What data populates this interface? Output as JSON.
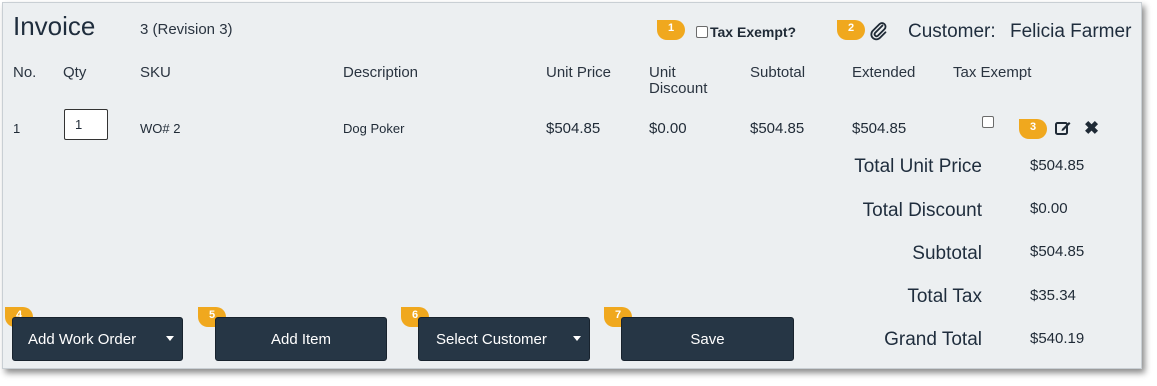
{
  "header": {
    "title": "Invoice",
    "revision": "3 (Revision 3)",
    "tax_exempt_label": "Tax Exempt?",
    "customer_label": "Customer:",
    "customer_name": "Felicia Farmer"
  },
  "table": {
    "columns": [
      "No.",
      "Qty",
      "SKU",
      "Description",
      "Unit Price",
      "Unit\nDiscount",
      "Subtotal",
      "Extended",
      "Tax Exempt"
    ],
    "rows": [
      {
        "no": "1",
        "qty": "1",
        "sku": "WO# 2",
        "description": "Dog Poker",
        "unit_price": "$504.85",
        "unit_discount": "$0.00",
        "subtotal": "$504.85",
        "extended": "$504.85",
        "tax_exempt": false
      }
    ]
  },
  "totals": [
    {
      "label": "Total Unit Price",
      "value": "$504.85"
    },
    {
      "label": "Total Discount",
      "value": "$0.00"
    },
    {
      "label": "Subtotal",
      "value": "$504.85"
    },
    {
      "label": "Total Tax",
      "value": "$35.34"
    },
    {
      "label": "Grand Total",
      "value": "$540.19"
    }
  ],
  "buttons": {
    "add_work_order": "Add Work Order",
    "add_item": "Add Item",
    "select_customer": "Select Customer",
    "save": "Save"
  },
  "badges": [
    "1",
    "2",
    "3",
    "4",
    "5",
    "6",
    "7"
  ],
  "colors": {
    "panel_bg": "#eceff1",
    "button_bg": "#263645",
    "badge": "#f0a81e",
    "text": "#1f2a36"
  },
  "icons": {
    "attachment": "paperclip-icon",
    "edit": "edit-icon",
    "delete": "close-icon"
  }
}
